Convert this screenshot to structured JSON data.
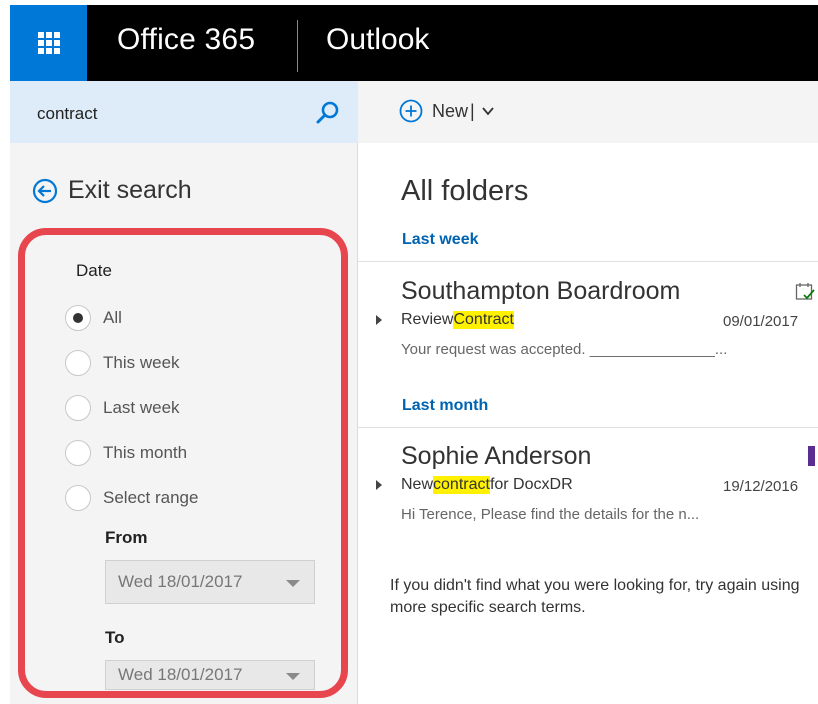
{
  "header": {
    "brand": "Office 365",
    "app": "Outlook"
  },
  "search": {
    "query": "contract"
  },
  "exit_search": {
    "label": "Exit search"
  },
  "date_filter": {
    "title": "Date",
    "options": [
      {
        "label": "All",
        "selected": true
      },
      {
        "label": "This week",
        "selected": false
      },
      {
        "label": "Last week",
        "selected": false
      },
      {
        "label": "This month",
        "selected": false
      },
      {
        "label": "Select range",
        "selected": false
      }
    ],
    "from_label": "From",
    "from_value": "Wed 18/01/2017",
    "to_label": "To",
    "to_value": "Wed 18/01/2017"
  },
  "toolbar": {
    "new_label": "New",
    "divider": "|"
  },
  "mail_list": {
    "title": "All folders",
    "groups": [
      {
        "label": "Last week",
        "messages": [
          {
            "from": "Southampton Boardroom",
            "subject_before": "Review ",
            "subject_highlight": "Contract",
            "subject_after": "",
            "date": "09/01/2017",
            "preview": "Your request was accepted. _______________...",
            "indicator": "calendar-icon"
          }
        ]
      },
      {
        "label": "Last month",
        "messages": [
          {
            "from": "Sophie Anderson",
            "subject_before": "New ",
            "subject_highlight": "contract",
            "subject_after": " for DocxDR",
            "date": "19/12/2016",
            "preview": "Hi Terence,   Please find the details for the n...",
            "indicator": "category-flag",
            "indicator_color": "#5c2d91"
          }
        ]
      }
    ],
    "no_more_text": "If you didn't find what you were looking for, try again using more specific search terms."
  },
  "colors": {
    "accent": "#0078d7",
    "highlight": "#fff100",
    "filter_outline": "#e8464e",
    "group_label": "#0063b1"
  }
}
